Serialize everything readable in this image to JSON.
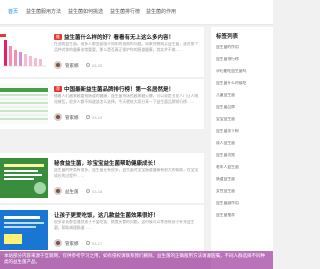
{
  "nav": {
    "items": [
      "首页",
      "益生菌服用方法",
      "益生菌如何挑选",
      "益生菌排行榜",
      "益生菌的作用"
    ]
  },
  "articles": [
    {
      "tag": "",
      "title": "益生菌什么样的好？看看有无上这么多内容！",
      "excerpt": "在选购益生菌，很多人都会面临不知如何选购的问题。如果你想购买益生菌，选对那个品种对你的健康非常重要，那么是否真正保护你的肠道健康，其实并不难……",
      "author": "管家娜",
      "date": "03-20"
    },
    {
      "tag": "",
      "title": "中国最新益生菌品牌排行榜！第一名居然是！",
      "excerpt": "随着人们越来越重视肠道的健康，益生菌市场也越来越火爆，可以说是五花八门让人眼花缭乱，很多人都不知道该怎么选择，今天就给大家分享一下益生菌品牌排行榜……",
      "author": "管家娜",
      "date": "03-19"
    },
    {
      "tag": "",
      "title": "秘食益生菌，珍宝宝益生菌帮助健康成长！",
      "excerpt": "益生菌的种类有很多，益生菌还有很多，益生菌对宝宝肠道健康有很大的帮助，在宝宝成长的过程中……",
      "author": "益生菌",
      "date": "03-18"
    },
    {
      "tag": "",
      "title": "让孩子更爱吃饭，这几款益生菌效果很好！",
      "excerpt": "很多家长都会遇到孩子不爱吃饭、挑食厌食的问题，这时候可以考虑给孩子补充益生菌，帮助调理肠道……",
      "author": "管家娜",
      "date": "03-17"
    }
  ],
  "sidebar": {
    "title": "标签列表",
    "items": [
      "益生菌的作用",
      "益生菌排行榜",
      "孕妇能吃益生菌吗",
      "益生菌什么时候吃",
      "儿童益生菌",
      "益生菌品牌",
      "宝宝益生菌",
      "益生菌冻干粉",
      "成人益生菌",
      "益生菌功效",
      "老年人益生菌",
      "肠道益生菌",
      "女性益生菌",
      "益生菌副作用",
      "益生菌推荐"
    ]
  },
  "banner": {
    "text": "本站部分内容来源于互联网，仅供参考学习之用，如有侵权请联系我们删除。益生菌的正确服用方法请遵医嘱，不同人群选择不同种类的益生菌产品。"
  }
}
